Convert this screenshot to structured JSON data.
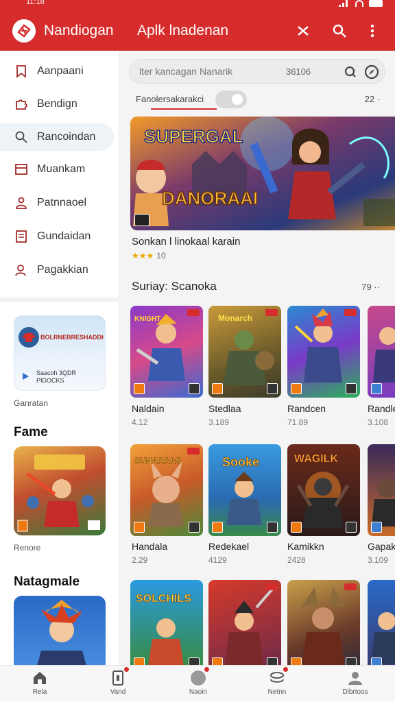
{
  "status": {
    "time": "11:18"
  },
  "header": {
    "app_name": "Nandiogan",
    "page_title": "Aplk lnadenan"
  },
  "sidebar": {
    "items": [
      {
        "label": "Aanpaani",
        "icon": "bookmark-icon"
      },
      {
        "label": "Bendign",
        "icon": "puzzle-icon"
      },
      {
        "label": "Rancoindan",
        "icon": "search-icon"
      },
      {
        "label": "Muankam",
        "icon": "window-icon"
      },
      {
        "label": "Patnnaoel",
        "icon": "person-icon"
      },
      {
        "label": "Gundaidan",
        "icon": "list-icon"
      },
      {
        "label": "Pagakkian",
        "icon": "user-icon"
      }
    ],
    "promo": {
      "title": "BOLRNEBRESHADDK",
      "line1": "Saacoh 3QDR",
      "line2": "PIDOCKS",
      "caption": "Ganratan"
    },
    "section1": {
      "title": "Fame",
      "caption": "Renore"
    },
    "section2": {
      "title": "Natagmale"
    }
  },
  "search": {
    "placeholder": "lter kancagan Nanarik",
    "value": "36106"
  },
  "filter": {
    "label": "Fanolersakarakci",
    "count": "22 ·"
  },
  "featured": {
    "banner_title": "SUPERGAL",
    "banner_sub": "DANORAAI",
    "title": "Sonkan l linokaal karain",
    "stars": "★★★",
    "rating": "10"
  },
  "section": {
    "title": "Suriay: Scanoka",
    "count": "79 ··"
  },
  "games": [
    {
      "name": "Naldain",
      "value": "4.12",
      "art": "KNIGHT"
    },
    {
      "name": "Stedlaa",
      "value": "3.189",
      "art": "Monarch"
    },
    {
      "name": "Randcen",
      "value": "71.89",
      "art": ""
    },
    {
      "name": "Randle",
      "value": "3.108",
      "art": ""
    },
    {
      "name": "Handala",
      "value": "2.29",
      "art": "SUNARAAS"
    },
    {
      "name": "Redekael",
      "value": "4129",
      "art": "Sooke"
    },
    {
      "name": "Kamikkn",
      "value": "2428",
      "art": "WAGILK"
    },
    {
      "name": "Gapak",
      "value": "3.109",
      "art": ""
    },
    {
      "name": "",
      "value": "",
      "art": "SOLCHILS"
    },
    {
      "name": "",
      "value": "",
      "art": ""
    },
    {
      "name": "",
      "value": "",
      "art": ""
    },
    {
      "name": "",
      "value": "",
      "art": ""
    }
  ],
  "bottom_nav": [
    {
      "label": "Rela",
      "icon": "home-icon"
    },
    {
      "label": "Vand",
      "icon": "phone-icon"
    },
    {
      "label": "Naoin",
      "icon": "circle-icon"
    },
    {
      "label": "Netnn",
      "icon": "stack-icon"
    },
    {
      "label": "Dibrtoos",
      "icon": "profile-icon"
    }
  ],
  "colors": {
    "accent": "#d62c2c",
    "sidebar_active": "#eef3f8"
  }
}
